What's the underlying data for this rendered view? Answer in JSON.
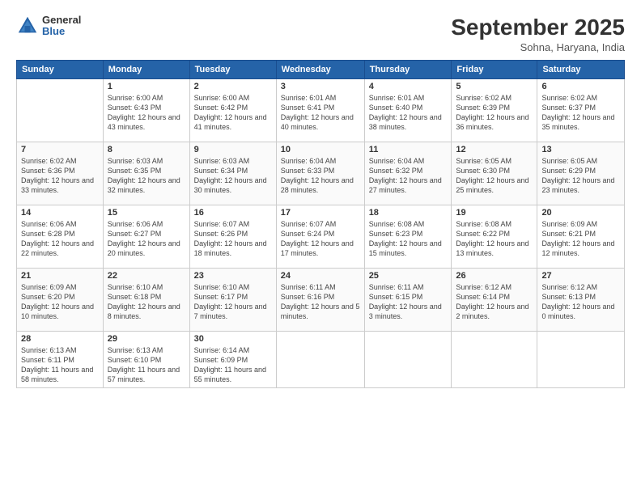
{
  "logo": {
    "general": "General",
    "blue": "Blue"
  },
  "header": {
    "month_year": "September 2025",
    "location": "Sohna, Haryana, India"
  },
  "days_of_week": [
    "Sunday",
    "Monday",
    "Tuesday",
    "Wednesday",
    "Thursday",
    "Friday",
    "Saturday"
  ],
  "weeks": [
    [
      {
        "day": "",
        "detail": ""
      },
      {
        "day": "1",
        "detail": "Sunrise: 6:00 AM\nSunset: 6:43 PM\nDaylight: 12 hours\nand 43 minutes."
      },
      {
        "day": "2",
        "detail": "Sunrise: 6:00 AM\nSunset: 6:42 PM\nDaylight: 12 hours\nand 41 minutes."
      },
      {
        "day": "3",
        "detail": "Sunrise: 6:01 AM\nSunset: 6:41 PM\nDaylight: 12 hours\nand 40 minutes."
      },
      {
        "day": "4",
        "detail": "Sunrise: 6:01 AM\nSunset: 6:40 PM\nDaylight: 12 hours\nand 38 minutes."
      },
      {
        "day": "5",
        "detail": "Sunrise: 6:02 AM\nSunset: 6:39 PM\nDaylight: 12 hours\nand 36 minutes."
      },
      {
        "day": "6",
        "detail": "Sunrise: 6:02 AM\nSunset: 6:37 PM\nDaylight: 12 hours\nand 35 minutes."
      }
    ],
    [
      {
        "day": "7",
        "detail": "Sunrise: 6:02 AM\nSunset: 6:36 PM\nDaylight: 12 hours\nand 33 minutes."
      },
      {
        "day": "8",
        "detail": "Sunrise: 6:03 AM\nSunset: 6:35 PM\nDaylight: 12 hours\nand 32 minutes."
      },
      {
        "day": "9",
        "detail": "Sunrise: 6:03 AM\nSunset: 6:34 PM\nDaylight: 12 hours\nand 30 minutes."
      },
      {
        "day": "10",
        "detail": "Sunrise: 6:04 AM\nSunset: 6:33 PM\nDaylight: 12 hours\nand 28 minutes."
      },
      {
        "day": "11",
        "detail": "Sunrise: 6:04 AM\nSunset: 6:32 PM\nDaylight: 12 hours\nand 27 minutes."
      },
      {
        "day": "12",
        "detail": "Sunrise: 6:05 AM\nSunset: 6:30 PM\nDaylight: 12 hours\nand 25 minutes."
      },
      {
        "day": "13",
        "detail": "Sunrise: 6:05 AM\nSunset: 6:29 PM\nDaylight: 12 hours\nand 23 minutes."
      }
    ],
    [
      {
        "day": "14",
        "detail": "Sunrise: 6:06 AM\nSunset: 6:28 PM\nDaylight: 12 hours\nand 22 minutes."
      },
      {
        "day": "15",
        "detail": "Sunrise: 6:06 AM\nSunset: 6:27 PM\nDaylight: 12 hours\nand 20 minutes."
      },
      {
        "day": "16",
        "detail": "Sunrise: 6:07 AM\nSunset: 6:26 PM\nDaylight: 12 hours\nand 18 minutes."
      },
      {
        "day": "17",
        "detail": "Sunrise: 6:07 AM\nSunset: 6:24 PM\nDaylight: 12 hours\nand 17 minutes."
      },
      {
        "day": "18",
        "detail": "Sunrise: 6:08 AM\nSunset: 6:23 PM\nDaylight: 12 hours\nand 15 minutes."
      },
      {
        "day": "19",
        "detail": "Sunrise: 6:08 AM\nSunset: 6:22 PM\nDaylight: 12 hours\nand 13 minutes."
      },
      {
        "day": "20",
        "detail": "Sunrise: 6:09 AM\nSunset: 6:21 PM\nDaylight: 12 hours\nand 12 minutes."
      }
    ],
    [
      {
        "day": "21",
        "detail": "Sunrise: 6:09 AM\nSunset: 6:20 PM\nDaylight: 12 hours\nand 10 minutes."
      },
      {
        "day": "22",
        "detail": "Sunrise: 6:10 AM\nSunset: 6:18 PM\nDaylight: 12 hours\nand 8 minutes."
      },
      {
        "day": "23",
        "detail": "Sunrise: 6:10 AM\nSunset: 6:17 PM\nDaylight: 12 hours\nand 7 minutes."
      },
      {
        "day": "24",
        "detail": "Sunrise: 6:11 AM\nSunset: 6:16 PM\nDaylight: 12 hours\nand 5 minutes."
      },
      {
        "day": "25",
        "detail": "Sunrise: 6:11 AM\nSunset: 6:15 PM\nDaylight: 12 hours\nand 3 minutes."
      },
      {
        "day": "26",
        "detail": "Sunrise: 6:12 AM\nSunset: 6:14 PM\nDaylight: 12 hours\nand 2 minutes."
      },
      {
        "day": "27",
        "detail": "Sunrise: 6:12 AM\nSunset: 6:13 PM\nDaylight: 12 hours\nand 0 minutes."
      }
    ],
    [
      {
        "day": "28",
        "detail": "Sunrise: 6:13 AM\nSunset: 6:11 PM\nDaylight: 11 hours\nand 58 minutes."
      },
      {
        "day": "29",
        "detail": "Sunrise: 6:13 AM\nSunset: 6:10 PM\nDaylight: 11 hours\nand 57 minutes."
      },
      {
        "day": "30",
        "detail": "Sunrise: 6:14 AM\nSunset: 6:09 PM\nDaylight: 11 hours\nand 55 minutes."
      },
      {
        "day": "",
        "detail": ""
      },
      {
        "day": "",
        "detail": ""
      },
      {
        "day": "",
        "detail": ""
      },
      {
        "day": "",
        "detail": ""
      }
    ]
  ]
}
